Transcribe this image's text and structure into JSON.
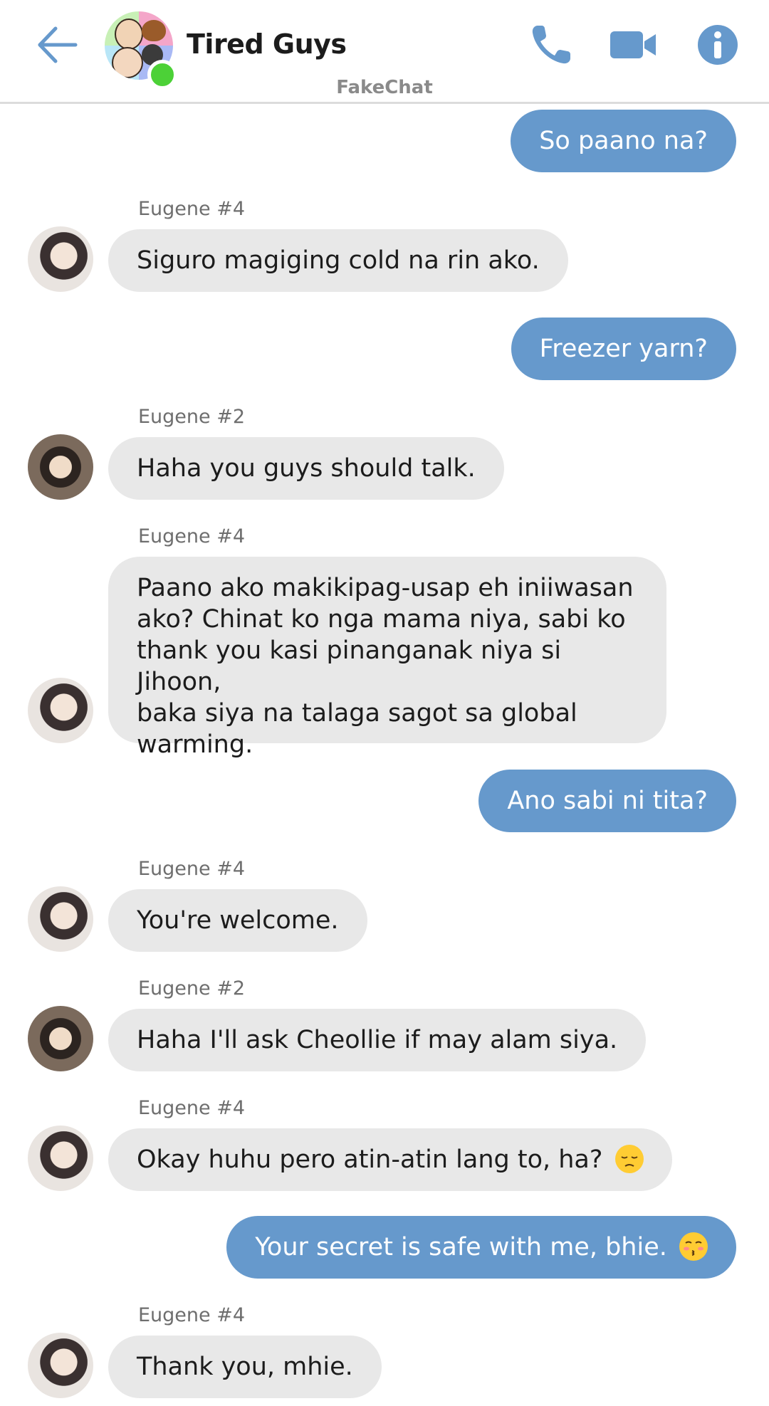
{
  "header": {
    "title": "Tired Guys",
    "watermark": "FakeChat",
    "back_icon": "arrow-left-icon",
    "call_icon": "phone-icon",
    "video_icon": "video-camera-icon",
    "info_icon": "info-icon",
    "accent_color": "#6699cc",
    "online_color": "#4cd137"
  },
  "messages": [
    {
      "type": "sent",
      "text": "So paano na?"
    },
    {
      "type": "received",
      "sender": "Eugene #4",
      "text": "Siguro magiging cold na rin ako."
    },
    {
      "type": "sent",
      "text": "Freezer yarn?"
    },
    {
      "type": "received",
      "sender": "Eugene #2",
      "text": "Haha you guys should talk."
    },
    {
      "type": "received",
      "sender": "Eugene #4",
      "lines": [
        "Paano ako makikipag-usap eh iniiwasan",
        "ako? Chinat ko nga mama niya, sabi ko",
        "thank you kasi pinanganak niya si Jihoon,",
        "baka siya na talaga sagot sa global",
        "warming."
      ]
    },
    {
      "type": "sent",
      "text": "Ano sabi ni tita?"
    },
    {
      "type": "received",
      "sender": "Eugene #4",
      "text": "You're welcome."
    },
    {
      "type": "received",
      "sender": "Eugene #2",
      "text": "Haha I'll ask Cheollie if may alam siya."
    },
    {
      "type": "received",
      "sender": "Eugene #4",
      "text": "Okay huhu pero atin-atin lang to, ha?",
      "emoji": "pensive-face-emoji"
    },
    {
      "type": "sent",
      "text": "Your secret is safe with me, bhie.",
      "emoji": "kissing-face-emoji"
    },
    {
      "type": "received",
      "sender": "Eugene #4",
      "text": "Thank you, mhie."
    }
  ]
}
